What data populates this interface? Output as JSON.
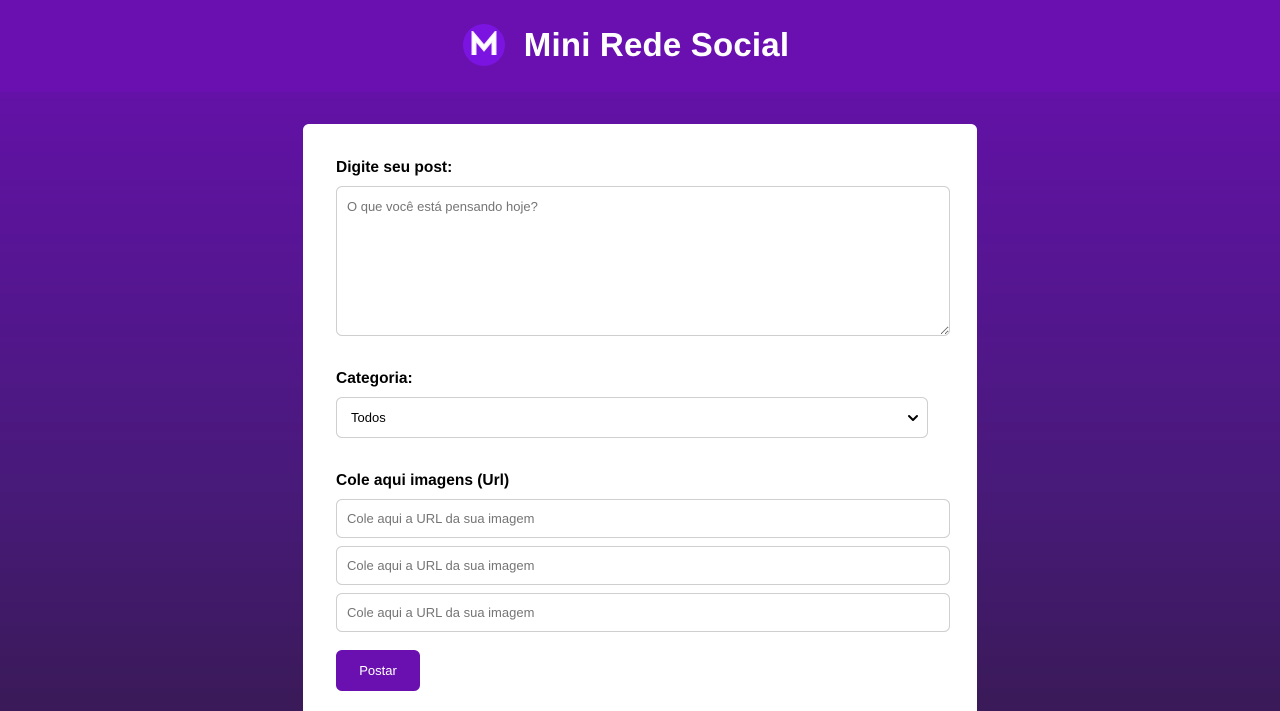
{
  "header": {
    "logo_letter": "M",
    "title": "Mini Rede Social"
  },
  "form": {
    "post_label": "Digite seu post:",
    "post_placeholder": "O que você está pensando hoje?",
    "category_label": "Categoria:",
    "category_selected": "Todos",
    "images_label": "Cole aqui imagens (Url)",
    "image_inputs": [
      {
        "placeholder": "Cole aqui a URL da sua imagem"
      },
      {
        "placeholder": "Cole aqui a URL da sua imagem"
      },
      {
        "placeholder": "Cole aqui a URL da sua imagem"
      }
    ],
    "submit_label": "Postar"
  },
  "colors": {
    "brand_purple": "#6a0fb0",
    "logo_bg": "#7b14e0",
    "card_bg": "#ffffff"
  },
  "icons": {
    "logo": "m-logo-icon",
    "select": "chevron-down-icon"
  }
}
